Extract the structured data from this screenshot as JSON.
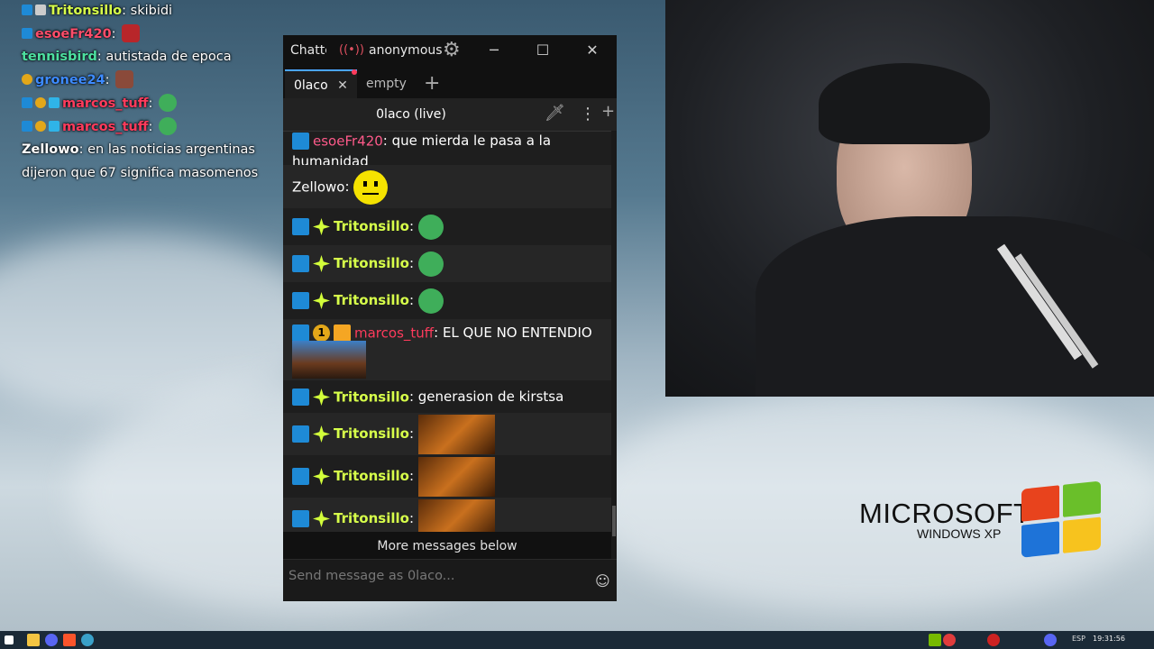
{
  "overlay_chat": {
    "lines": [
      {
        "user": "Tritonsillo",
        "text": "skibidi",
        "color": "#d7ff4a"
      },
      {
        "user": "esoeFr420",
        "text": "",
        "color": "#ff4d6a"
      },
      {
        "user": "tennisbird",
        "text": "autistada de epoca",
        "color": "#4de0a0"
      },
      {
        "user": "gronee24",
        "text": "",
        "color": "#3d8bff"
      },
      {
        "user": "marcos_tuff",
        "text": "",
        "color": "#ff3b5c"
      },
      {
        "user": "marcos_tuff",
        "text": "",
        "color": "#ff3b5c"
      },
      {
        "user": "Zellowo",
        "text": "en las noticias argentinas dijeron que 67 significa masomenos",
        "color": "#ffffff"
      }
    ]
  },
  "window": {
    "app_title": "Chatterino",
    "account": "anonymous",
    "tabs": [
      {
        "label": "0laco",
        "active": true
      },
      {
        "label": "empty",
        "active": false
      }
    ],
    "add_tab": "+",
    "channel_title": "0laco (live)",
    "add_split": "+",
    "more_below": "More messages below",
    "input_placeholder": "Send message as 0laco..."
  },
  "messages": [
    {
      "user": "esoeFr420",
      "text": "que mierda le pasa a la humanidad",
      "color": "#ff5a8a"
    },
    {
      "user": "Zellowo",
      "text": "",
      "color": "#ffffff",
      "emote": "smiley"
    },
    {
      "user": "Tritonsillo",
      "text": "",
      "color": "#d7ff4a",
      "emote": "pepe"
    },
    {
      "user": "Tritonsillo",
      "text": "",
      "color": "#d7ff4a",
      "emote": "pepe"
    },
    {
      "user": "Tritonsillo",
      "text": "",
      "color": "#d7ff4a",
      "emote": "pepe"
    },
    {
      "user": "marcos_tuff",
      "text": "EL QUE NO ENTENDIO",
      "color": "#ff3b5c",
      "emote": "face"
    },
    {
      "user": "Tritonsillo",
      "text": "generasion de kirstsa",
      "color": "#d7ff4a"
    },
    {
      "user": "Tritonsillo",
      "text": "",
      "color": "#d7ff4a",
      "emote": "image"
    },
    {
      "user": "Tritonsillo",
      "text": "",
      "color": "#d7ff4a",
      "emote": "image"
    },
    {
      "user": "Tritonsillo",
      "text": "",
      "color": "#d7ff4a",
      "emote": "image"
    }
  ],
  "watermark": {
    "brand": "MICROSOFT",
    "product": "WINDOWS XP"
  },
  "taskbar": {
    "language": "ESP",
    "clock": "19:31:56"
  }
}
